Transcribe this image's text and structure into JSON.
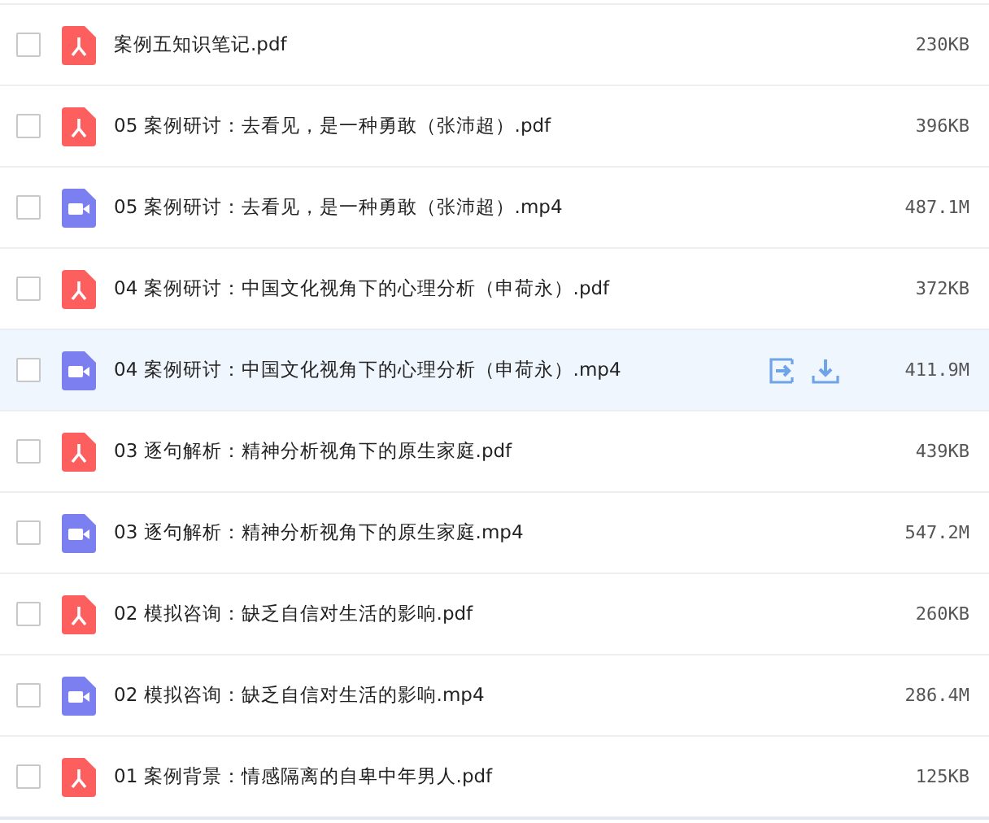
{
  "files": [
    {
      "kind": "pdf",
      "name": "案例五知识笔记.pdf",
      "size": "230KB",
      "checked": false,
      "highlighted": false
    },
    {
      "kind": "pdf",
      "name": "05 案例研讨：去看见，是一种勇敢（张沛超）.pdf",
      "size": "396KB",
      "checked": false,
      "highlighted": false
    },
    {
      "kind": "video",
      "name": "05 案例研讨：去看见，是一种勇敢（张沛超）.mp4",
      "size": "487.1M",
      "checked": false,
      "highlighted": false
    },
    {
      "kind": "pdf",
      "name": "04 案例研讨：中国文化视角下的心理分析（申荷永）.pdf",
      "size": "372KB",
      "checked": false,
      "highlighted": false
    },
    {
      "kind": "video",
      "name": "04 案例研讨：中国文化视角下的心理分析（申荷永）.mp4",
      "size": "411.9M",
      "checked": false,
      "highlighted": true
    },
    {
      "kind": "pdf",
      "name": "03 逐句解析：精神分析视角下的原生家庭.pdf",
      "size": "439KB",
      "checked": false,
      "highlighted": false
    },
    {
      "kind": "video",
      "name": "03 逐句解析：精神分析视角下的原生家庭.mp4",
      "size": "547.2M",
      "checked": false,
      "highlighted": false
    },
    {
      "kind": "pdf",
      "name": "02 模拟咨询：缺乏自信对生活的影响.pdf",
      "size": "260KB",
      "checked": false,
      "highlighted": false
    },
    {
      "kind": "video",
      "name": "02 模拟咨询：缺乏自信对生活的影响.mp4",
      "size": "286.4M",
      "checked": false,
      "highlighted": false
    },
    {
      "kind": "pdf",
      "name": "01 案例背景：情感隔离的自卑中年男人.pdf",
      "size": "125KB",
      "checked": false,
      "highlighted": false
    }
  ]
}
